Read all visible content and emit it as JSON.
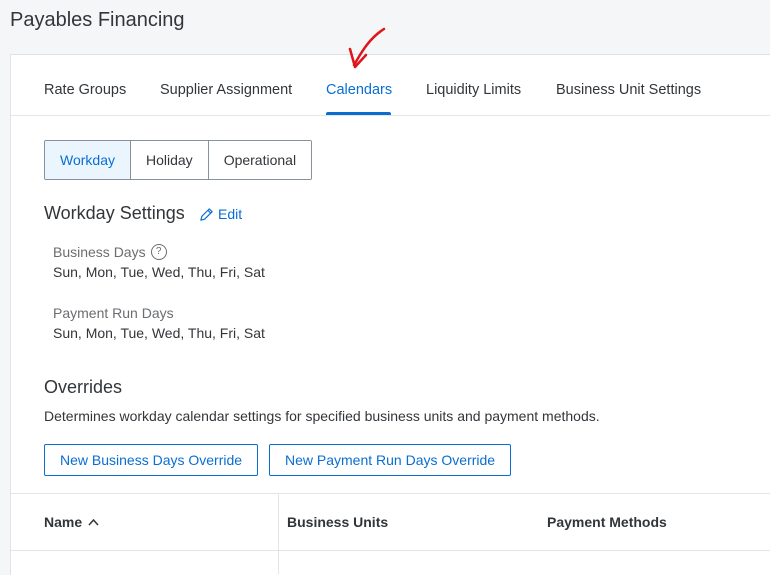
{
  "page": {
    "title": "Payables Financing"
  },
  "tabs": [
    {
      "label": "Rate Groups"
    },
    {
      "label": "Supplier Assignment"
    },
    {
      "label": "Calendars",
      "active": true
    },
    {
      "label": "Liquidity Limits"
    },
    {
      "label": "Business Unit Settings"
    }
  ],
  "segments": [
    {
      "label": "Workday",
      "selected": true
    },
    {
      "label": "Holiday"
    },
    {
      "label": "Operational"
    }
  ],
  "workday_settings": {
    "title": "Workday Settings",
    "edit_label": "Edit",
    "business_days_label": "Business Days",
    "business_days_value": "Sun, Mon, Tue, Wed, Thu, Fri, Sat",
    "payment_run_days_label": "Payment Run Days",
    "payment_run_days_value": "Sun, Mon, Tue, Wed, Thu, Fri, Sat",
    "help_glyph": "?"
  },
  "overrides": {
    "title": "Overrides",
    "description": "Determines workday calendar settings for specified business units and payment methods.",
    "new_business_days_button": "New Business Days Override",
    "new_payment_run_days_button": "New Payment Run Days Override"
  },
  "table": {
    "columns": [
      {
        "label": "Name",
        "sort": "ascending"
      },
      {
        "label": "Business Units"
      },
      {
        "label": "Payment Methods"
      }
    ]
  },
  "colors": {
    "accent": "#0a6ed1",
    "annotation": "#e0141b"
  },
  "icons": {
    "edit": "pencil-icon",
    "help": "question-circle-icon",
    "sort": "chevron-up-icon",
    "annotation": "red-arrow-icon"
  }
}
